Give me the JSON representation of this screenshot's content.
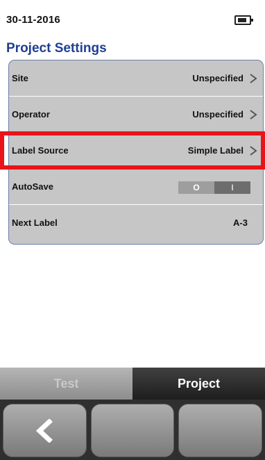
{
  "status": {
    "date": "30-11-2016",
    "battery_icon": "battery-icon"
  },
  "page": {
    "title": "Project Settings"
  },
  "settings": {
    "rows": [
      {
        "label": "Site",
        "value": "Unspecified",
        "icon": "chevron-right-icon"
      },
      {
        "label": "Operator",
        "value": "Unspecified",
        "icon": "chevron-right-icon"
      },
      {
        "label": "Label Source",
        "value": "Simple Label",
        "icon": "chevron-right-icon"
      },
      {
        "label": "AutoSave",
        "toggle": {
          "off_label": "O",
          "on_label": "I",
          "state": "off"
        }
      },
      {
        "label": "Next Label",
        "value": "A-3"
      }
    ]
  },
  "tabs": [
    {
      "label": "Test",
      "active": false
    },
    {
      "label": "Project",
      "active": true
    }
  ],
  "softkeys": [
    {
      "icon": "back-arrow-icon"
    },
    {
      "icon": ""
    },
    {
      "icon": ""
    }
  ],
  "colors": {
    "title": "#1f3f94",
    "panel_bg": "#c6c6c6",
    "highlight": "#e8141a"
  }
}
